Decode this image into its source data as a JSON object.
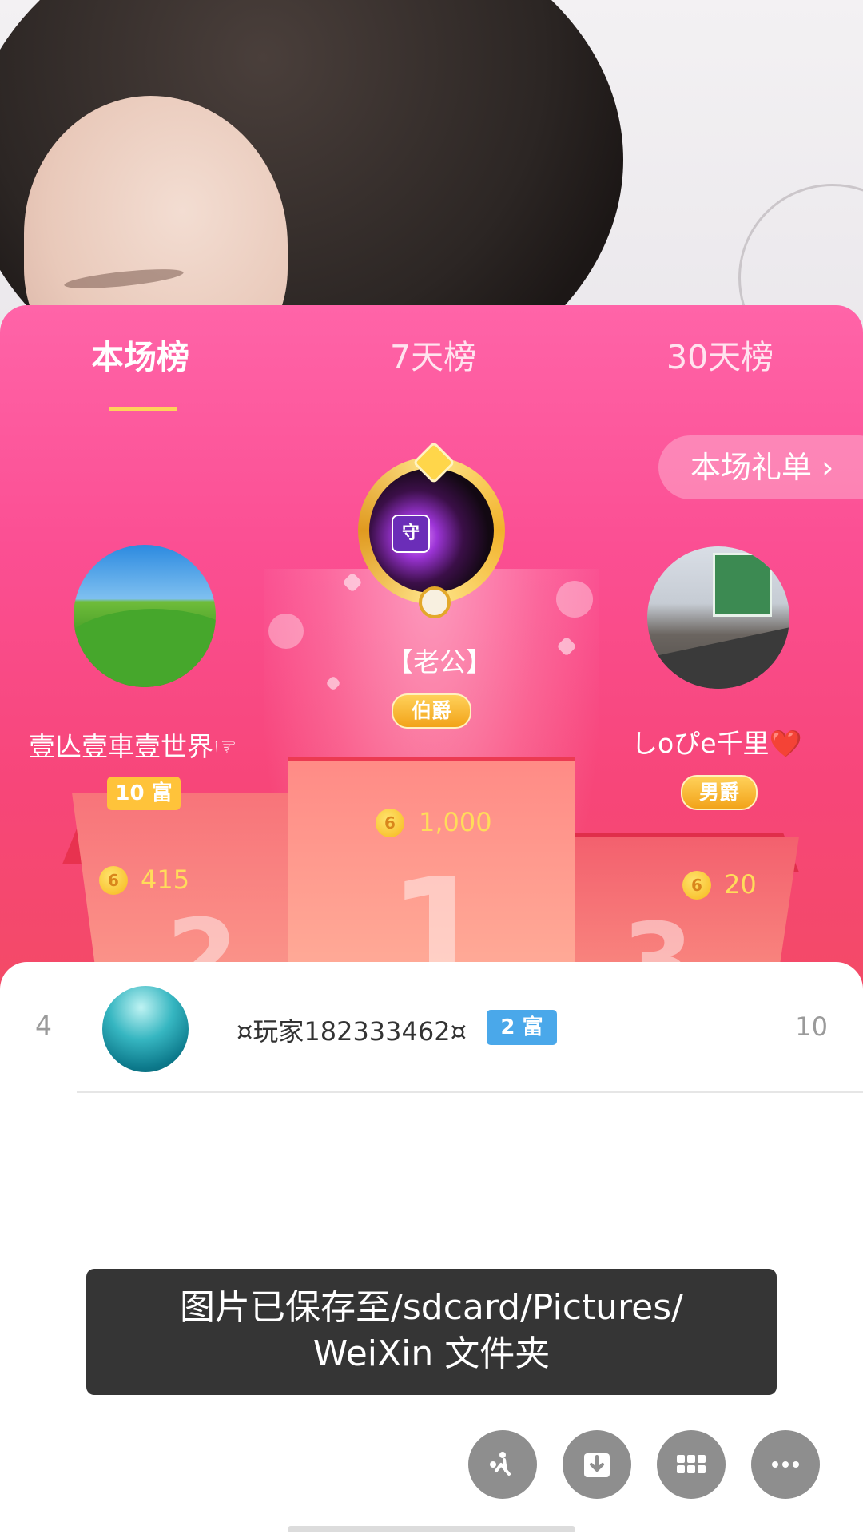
{
  "tabs": {
    "current": "本场榜",
    "week": "7天榜",
    "month": "30天榜"
  },
  "gift_list_button": "本场礼单 ›",
  "podium": {
    "first": {
      "name": "【老公】",
      "title_badge": "伯爵",
      "coin": "6",
      "score": "1,000",
      "guard_icon": "守"
    },
    "second": {
      "name": "壹亾壹車壹世界☞",
      "level_badge": "10 富",
      "coin": "6",
      "score": "415"
    },
    "third": {
      "name": "しoぴe千里❤️",
      "title_badge": "男爵",
      "coin": "6",
      "score": "20"
    }
  },
  "list": [
    {
      "rank": "4",
      "name": "¤玩家182333462¤",
      "badge": "2 富",
      "score": "10"
    }
  ],
  "toast": {
    "line1": "图片已保存至/sdcard/Pictures/",
    "line2": "WeiXin 文件夹"
  },
  "bottom_actions": {
    "icons": [
      "share-icon",
      "download-icon",
      "grid-icon",
      "more-icon"
    ]
  }
}
